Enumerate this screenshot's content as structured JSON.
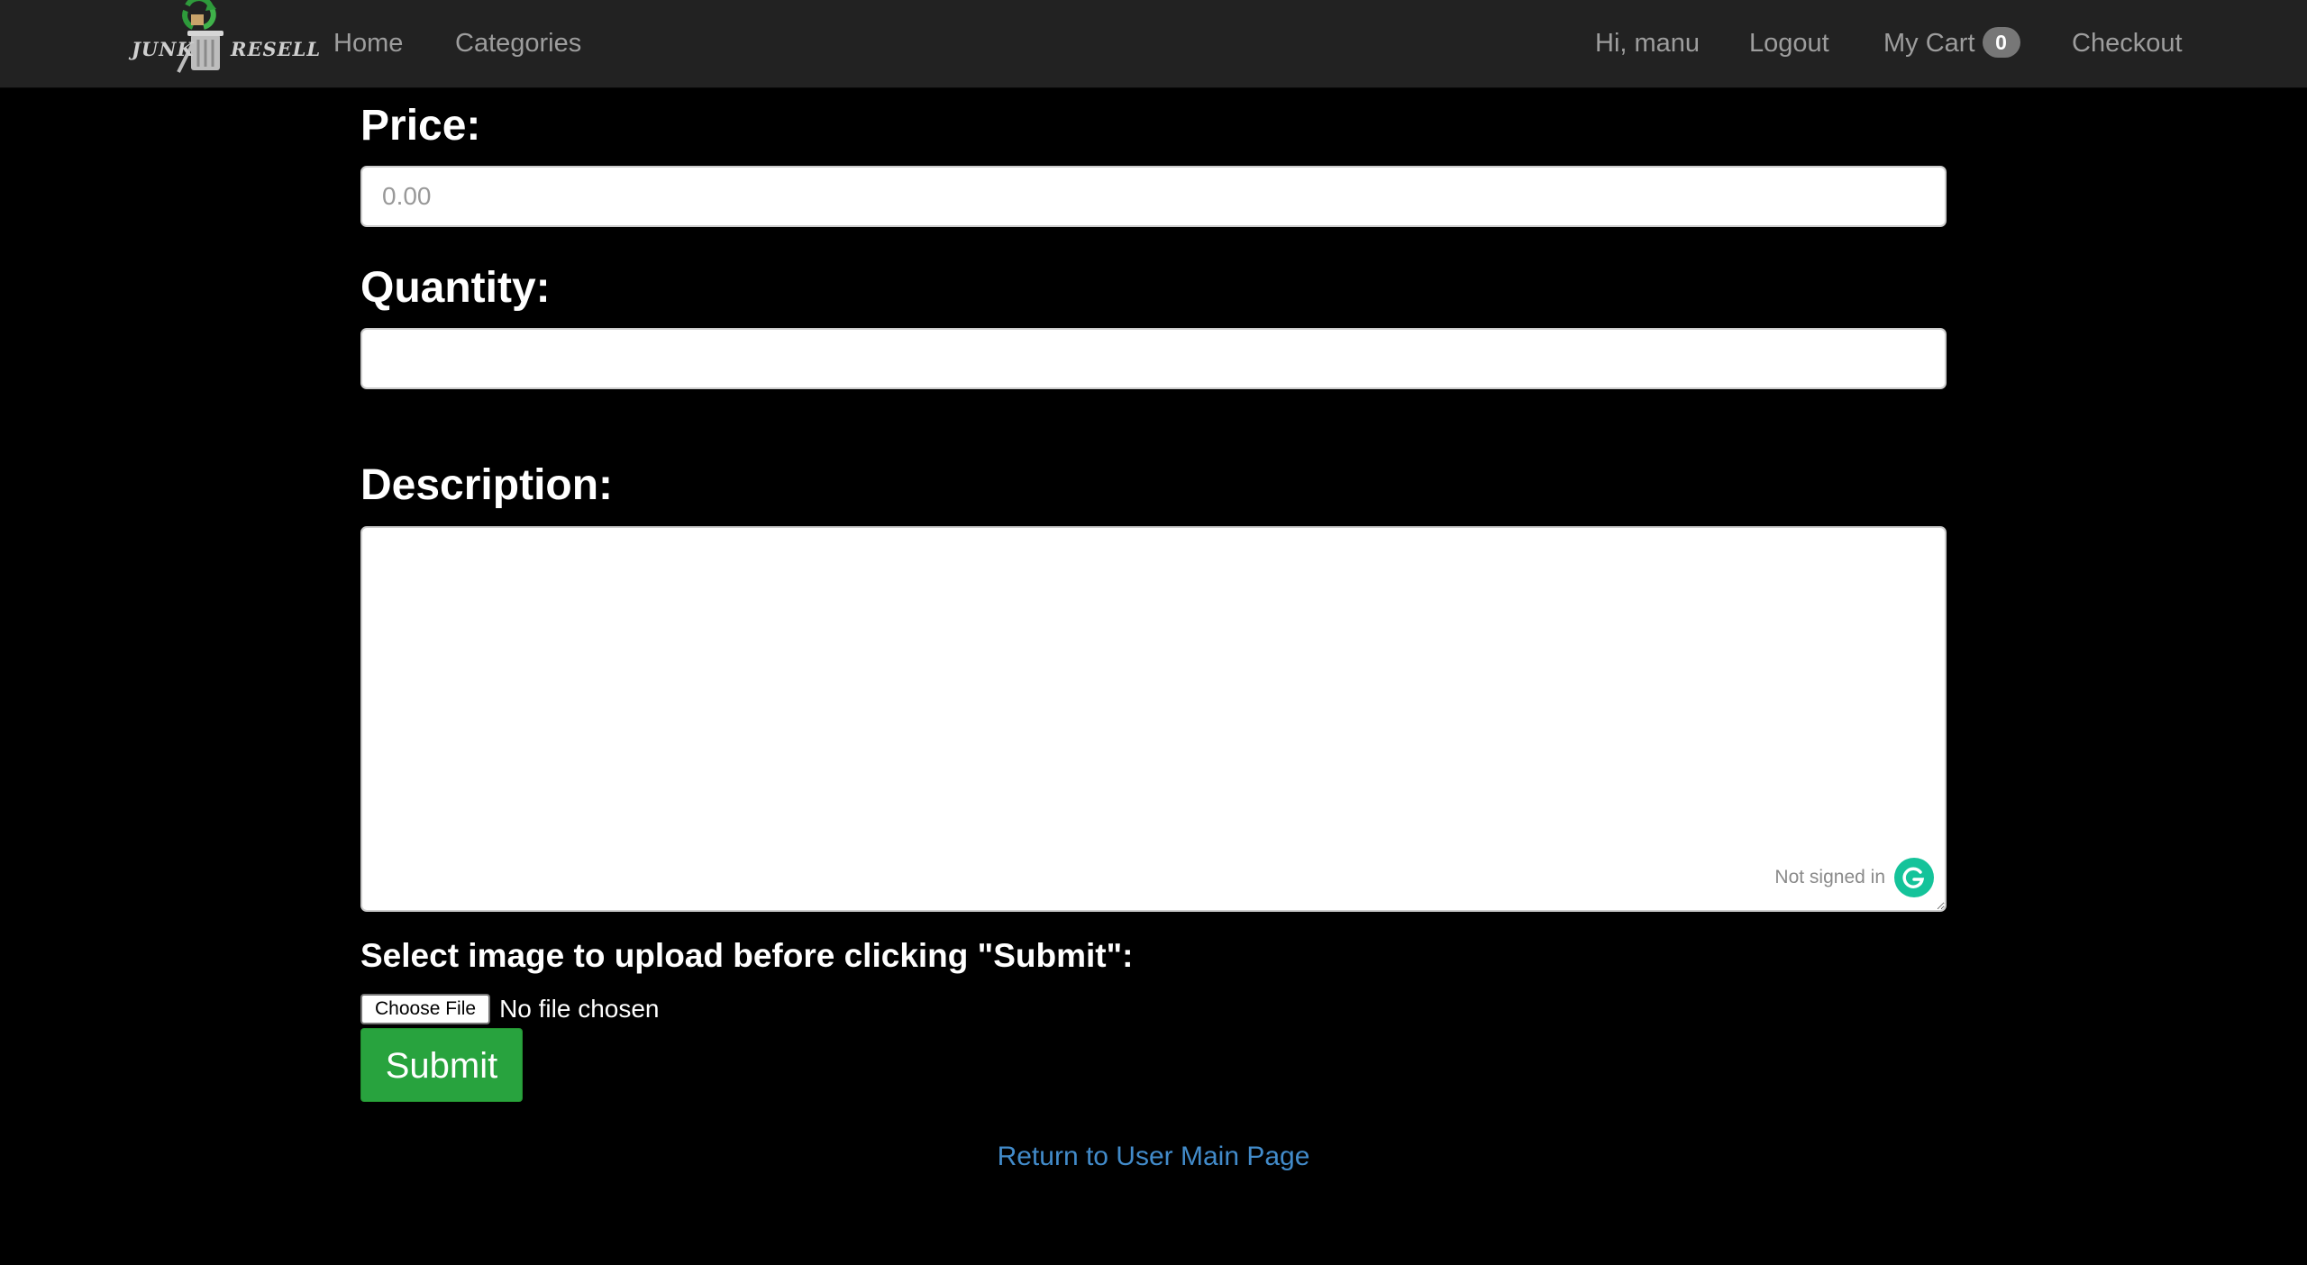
{
  "navbar": {
    "logo": {
      "text_left": "JUNK",
      "text_right": "RESELL"
    },
    "left_links": [
      {
        "label": "Home"
      },
      {
        "label": "Categories"
      }
    ],
    "greeting": "Hi, manu",
    "logout_label": "Logout",
    "cart_label": "My Cart",
    "cart_count": "0",
    "checkout_label": "Checkout"
  },
  "form": {
    "price_label": "Price:",
    "price_placeholder": "0.00",
    "price_value": "",
    "quantity_label": "Quantity:",
    "quantity_value": "",
    "description_label": "Description:",
    "description_value": "",
    "grammarly_status": "Not signed in",
    "upload_label": "Select image to upload before clicking \"Submit\":",
    "choose_file_label": "Choose File",
    "file_status": "No file chosen",
    "submit_label": "Submit"
  },
  "footer": {
    "return_link": "Return to User Main Page"
  },
  "colors": {
    "navbar_bg": "#222222",
    "nav_text": "#9d9d9d",
    "page_bg": "#000000",
    "submit_green": "#28a33e",
    "link_blue": "#428bca",
    "grammarly_green": "#15c39a"
  },
  "icons": [
    "junk-resell-logo",
    "grammarly-icon"
  ]
}
